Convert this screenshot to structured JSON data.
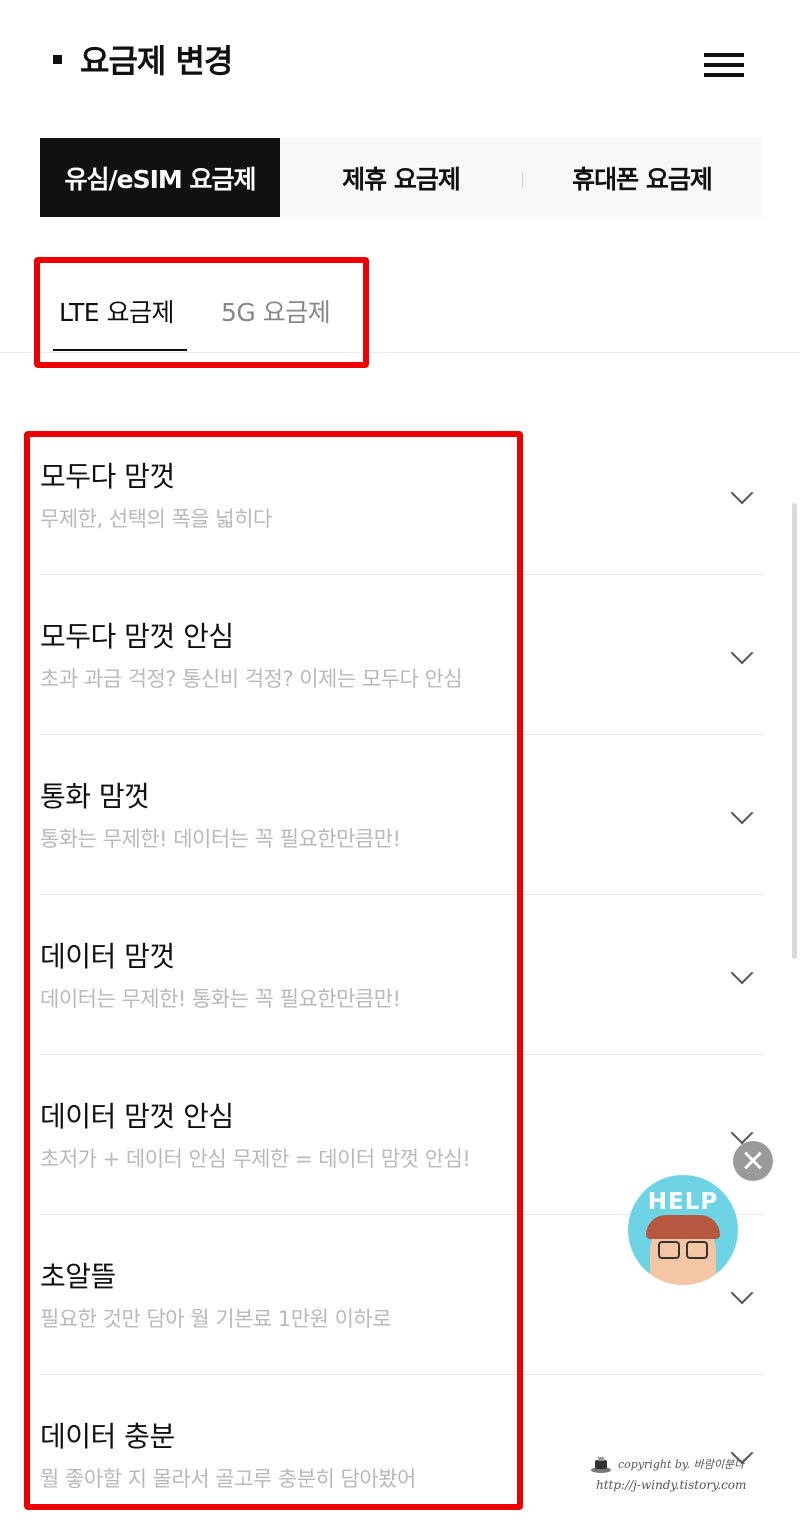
{
  "header": {
    "title": "요금제 변경",
    "menu_icon": "hamburger-menu-icon"
  },
  "main_tabs": [
    {
      "label": "유심/eSIM 요금제",
      "active": true
    },
    {
      "label": "제휴 요금제",
      "active": false
    },
    {
      "label": "휴대폰 요금제",
      "active": false
    }
  ],
  "sub_tabs": [
    {
      "label": "LTE 요금제",
      "active": true
    },
    {
      "label": "5G 요금제",
      "active": false
    }
  ],
  "plans": [
    {
      "name": "모두다 맘껏",
      "desc": "무제한, 선택의 폭을 넓히다"
    },
    {
      "name": "모두다 맘껏 안심",
      "desc": "초과 과금 걱정? 통신비 걱정? 이제는 모두다 안심"
    },
    {
      "name": "통화 맘껏",
      "desc": "통화는 무제한! 데이터는 꼭 필요한만큼만!"
    },
    {
      "name": "데이터 맘껏",
      "desc": "데이터는 무제한! 통화는 꼭 필요한만큼만!"
    },
    {
      "name": "데이터 맘껏 안심",
      "desc": "초저가 + 데이터 안심 무제한 = 데이터 맘껏 안심!"
    },
    {
      "name": "초알뜰",
      "desc": "필요한 것만 담아 월 기본료 1만원 이하로"
    },
    {
      "name": "데이터 충분",
      "desc": "뭘 좋아할 지 몰라서 골고루 충분히 담아봤어"
    }
  ],
  "help_widget": {
    "label": "HELP",
    "close_icon": "close-icon"
  },
  "watermark": {
    "line1": "copyright by. 바람이분다",
    "line2": "http://j-windy.tistory.com"
  },
  "colors": {
    "highlight": "#ee0000",
    "active_tab_bg": "#111111",
    "help_bg": "#6fd3e6"
  }
}
